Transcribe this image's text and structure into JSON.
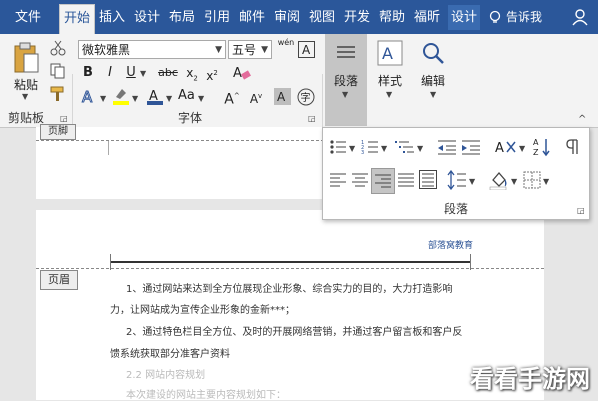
{
  "tabs": [
    "文件",
    "开始",
    "插入",
    "设计",
    "布局",
    "引用",
    "邮件",
    "审阅",
    "视图",
    "开发",
    "帮助",
    "福昕",
    "设计"
  ],
  "tell_me": "告诉我",
  "clipboard": {
    "paste_label": "粘贴",
    "group_label": "剪贴板"
  },
  "font": {
    "font_name": "微软雅黑",
    "font_size": "五号",
    "wen_label": "wén",
    "group_label": "字体"
  },
  "paragraph_group": {
    "label": "段落"
  },
  "style_group": {
    "label": "样式"
  },
  "edit_group": {
    "label": "编辑"
  },
  "paragraph_panel": {
    "label": "段落"
  },
  "document": {
    "header_tag_top": "页脚",
    "header_tag": "页眉",
    "header_text": "部落窝教育",
    "lines": [
      "1、通过网站来达到全方位展现企业形象、综合实力的目的，大力打造影响",
      "力，让网站成为宣传企业形象的金新***；",
      "2、通过特色栏目全方位、及时的开展网络营销，并通过客户留言板和客户反",
      "馈系统获取部分准客户资料",
      "2.2 网站内容规划",
      "本次建设的网站主要内容规划如下："
    ]
  },
  "watermark": "看看手游网",
  "colors": {
    "title_bar": "#2b579a",
    "ribbon": "#f3f3f3",
    "highlight": "#ffff00",
    "font_color": "#2f5597"
  }
}
